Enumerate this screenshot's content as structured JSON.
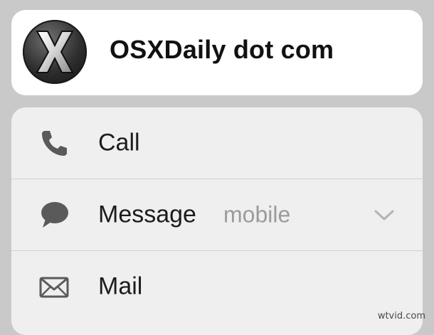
{
  "contact": {
    "name": "OSXDaily dot com",
    "avatar_icon": "x-logo-icon"
  },
  "actions": [
    {
      "label": "Call",
      "icon": "phone-icon"
    },
    {
      "label": "Message",
      "sublabel": "mobile",
      "icon": "message-bubble-icon",
      "expand_icon": "chevron-down-icon"
    },
    {
      "label": "Mail",
      "icon": "envelope-icon"
    }
  ],
  "watermark": "wtvid.com",
  "colors": {
    "background": "#c9c9c9",
    "card": "#ffffff",
    "panel": "#efefef",
    "icon": "#5a5a5a",
    "sublabel": "#9b9b9b"
  }
}
